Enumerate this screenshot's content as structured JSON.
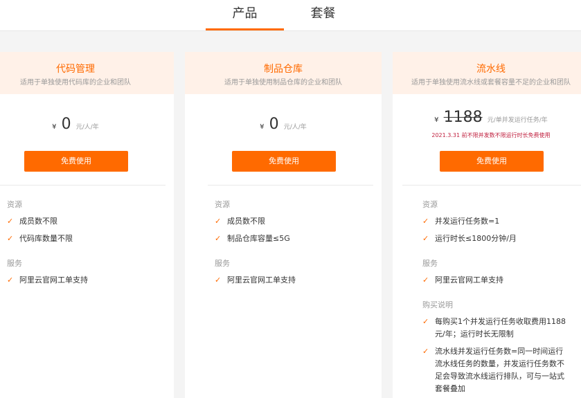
{
  "tabs": [
    {
      "label": "产品",
      "active": true
    },
    {
      "label": "套餐",
      "active": false
    }
  ],
  "accent_color": "#ff6a00",
  "cards": [
    {
      "title": "代码管理",
      "subtitle": "适用于单独使用代码库的企业和团队",
      "currency": "¥",
      "price": "0",
      "unit": "元/人/年",
      "button": "免费使用",
      "section1": "资源",
      "features1": [
        "成员数不限",
        "代码库数量不限"
      ],
      "section2": "服务",
      "features2": [
        "阿里云官网工单支持"
      ]
    },
    {
      "title": "制品仓库",
      "subtitle": "适用于单独使用制品仓库的企业和团队",
      "currency": "¥",
      "price": "0",
      "unit": "元/人/年",
      "button": "免费使用",
      "section1": "资源",
      "features1": [
        "成员数不限",
        "制品仓库容量≤5G"
      ],
      "section2": "服务",
      "features2": [
        "阿里云官网工单支持"
      ]
    },
    {
      "title": "流水线",
      "subtitle": "适用于单独使用流水线或套餐容量不足的企业和团队",
      "currency": "¥",
      "price": "1188",
      "unit": "元/单并发运行任务/年",
      "promo": "2021.3.31 前不限并发数不限运行时长免费使用",
      "button": "免费使用",
      "section1": "资源",
      "features1": [
        "并发运行任务数=1",
        "运行时长≤1800分钟/月"
      ],
      "section2": "服务",
      "features2": [
        "阿里云官网工单支持"
      ],
      "section3": "购买说明",
      "features3": [
        "每购买1个并发运行任务收取费用1188元/年；运行时长无限制",
        "流水线并发运行任务数=同一时间运行流水线任务的数量，并发运行任务数不足会导致流水线运行排队，可与一站式套餐叠加"
      ]
    }
  ]
}
